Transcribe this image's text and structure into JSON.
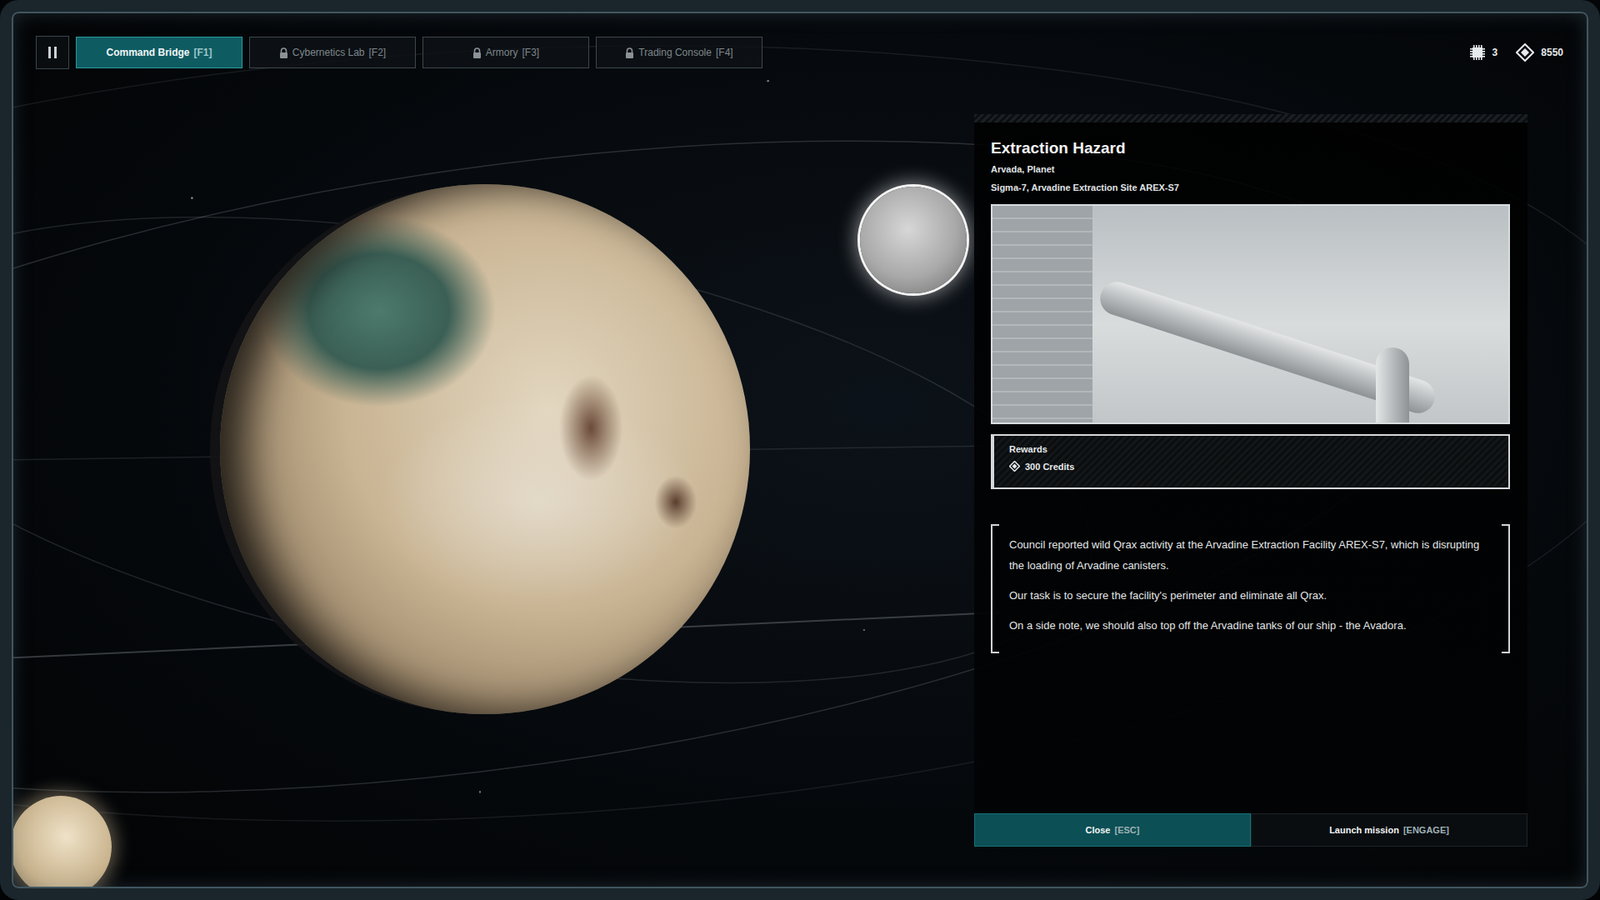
{
  "tabs": [
    {
      "label": "Command Bridge",
      "key": "[F1]",
      "selected": true,
      "locked": false
    },
    {
      "label": "Cybernetics Lab",
      "key": "[F2]",
      "selected": false,
      "locked": true
    },
    {
      "label": "Armory",
      "key": "[F3]",
      "selected": false,
      "locked": true
    },
    {
      "label": "Trading Console",
      "key": "[F4]",
      "selected": false,
      "locked": true
    }
  ],
  "resources": [
    {
      "kind": "chip",
      "value": "3"
    },
    {
      "kind": "credits",
      "value": "8550"
    }
  ],
  "mission": {
    "title": "Extraction Hazard",
    "location": "Arvada, Planet",
    "site": "Sigma-7, Arvadine Extraction Site AREX-S7",
    "rewards": {
      "label": "Rewards",
      "items": [
        "300 Credits"
      ]
    },
    "description": [
      "Council reported wild Qrax activity at the Arvadine Extraction Facility AREX-S7, which is disrupting the loading of Arvadine canisters.",
      "Our task is to secure the facility's perimeter and eliminate all Qrax.",
      "On a side note, we should also top off the Arvadine tanks of our ship - the Avadora."
    ]
  },
  "buttons": [
    {
      "label": "Close",
      "key": "[ESC]",
      "selected": true
    },
    {
      "label": "Launch mission",
      "key": "[ENGAGE]",
      "selected": false
    }
  ]
}
